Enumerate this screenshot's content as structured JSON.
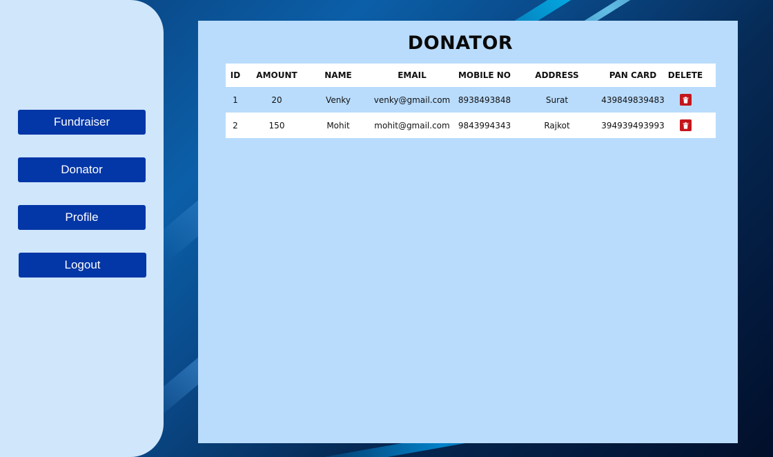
{
  "sidebar": {
    "items": [
      {
        "label": "Fundraiser"
      },
      {
        "label": "Donator"
      },
      {
        "label": "Profile"
      },
      {
        "label": "Logout"
      }
    ]
  },
  "main": {
    "title": "DONATOR",
    "table": {
      "headers": [
        "ID",
        "AMOUNT",
        "NAME",
        "EMAIL",
        "MOBILE NO",
        "ADDRESS",
        "PAN CARD",
        "DELETE"
      ],
      "rows": [
        {
          "id": "1",
          "amount": "20",
          "name": "Venky",
          "email": "venky@gmail.com",
          "mobile": "8938493848",
          "address": "Surat",
          "pan": "439849839483",
          "delete_icon": "trash-icon"
        },
        {
          "id": "2",
          "amount": "150",
          "name": "Mohit",
          "email": "mohit@gmail.com",
          "mobile": "9843994343",
          "address": "Rajkot",
          "pan": "394939493993",
          "delete_icon": "trash-icon"
        }
      ]
    }
  },
  "colors": {
    "sidebar_bg": "#cfe6fb",
    "nav_button": "#0336a6",
    "panel_bg": "#b9dcfc",
    "delete_button": "#c4161c"
  }
}
